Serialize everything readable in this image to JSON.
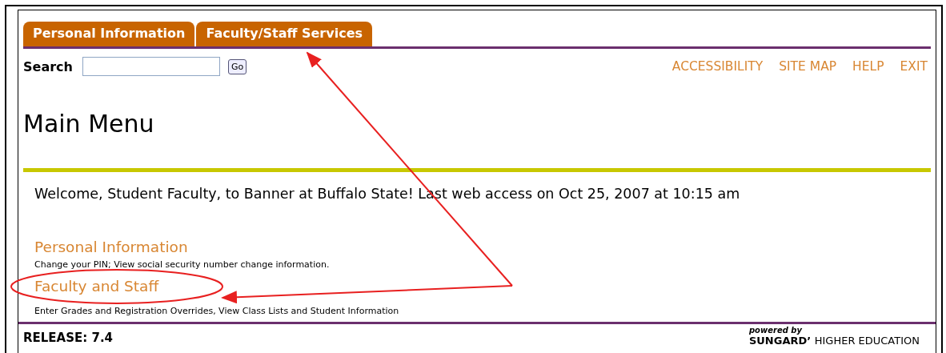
{
  "tabs": [
    {
      "label": "Personal Information"
    },
    {
      "label": "Faculty/Staff Services"
    }
  ],
  "search": {
    "label": "Search",
    "button": "Go"
  },
  "top_links": [
    "ACCESSIBILITY",
    "SITE MAP",
    "HELP",
    "EXIT"
  ],
  "title": "Main Menu",
  "welcome": "Welcome, Student Faculty, to Banner at Buffalo State! Last web access on Oct 25, 2007 at 10:15 am",
  "menu": [
    {
      "link": "Personal Information",
      "description": "Change your PIN; View social security number change information."
    },
    {
      "link": "Faculty and Staff",
      "description": "Enter Grades and Registration Overrides, View Class Lists and Student Information"
    }
  ],
  "footer": {
    "release": "RELEASE: 7.4",
    "powered_by": "powered by",
    "brand": "SUNGARD’",
    "brand_rest": "HIGHER EDUCATION"
  }
}
